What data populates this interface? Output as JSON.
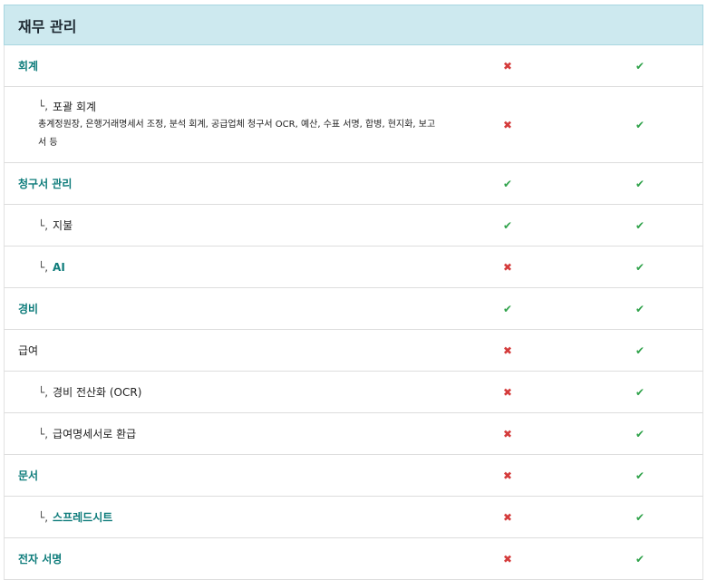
{
  "section": {
    "title": "재무 관리"
  },
  "icons": {
    "check": "✔",
    "cross": "✖",
    "arrow": "└,"
  },
  "colors": {
    "header_bg": "#cde9ef",
    "link": "#0e7c7b",
    "check": "#2fa24a",
    "cross": "#d43a3a"
  },
  "rows": [
    {
      "label": "회계",
      "style": "link",
      "indent": false,
      "col1": "no",
      "col2": "yes"
    },
    {
      "label": "포괄 회계",
      "style": "plain",
      "indent": true,
      "description": "총계정원장, 은행거래명세서 조정, 분석 회계, 공급업체 청구서 OCR, 예산, 수표 서명, 합병, 현지화, 보고서 등",
      "col1": "no",
      "col2": "yes"
    },
    {
      "label": "청구서 관리",
      "style": "link",
      "indent": false,
      "col1": "yes",
      "col2": "yes"
    },
    {
      "label": "지불",
      "style": "plain",
      "indent": true,
      "col1": "yes",
      "col2": "yes"
    },
    {
      "label": "AI",
      "style": "link",
      "indent": true,
      "col1": "no",
      "col2": "yes"
    },
    {
      "label": "경비",
      "style": "link",
      "indent": false,
      "col1": "yes",
      "col2": "yes"
    },
    {
      "label": "급여",
      "style": "plain",
      "indent": false,
      "col1": "no",
      "col2": "yes"
    },
    {
      "label": "경비 전산화 (OCR)",
      "style": "plain",
      "indent": true,
      "col1": "no",
      "col2": "yes"
    },
    {
      "label": "급여명세서로 환급",
      "style": "plain",
      "indent": true,
      "col1": "no",
      "col2": "yes"
    },
    {
      "label": "문서",
      "style": "link",
      "indent": false,
      "col1": "no",
      "col2": "yes"
    },
    {
      "label": "스프레드시트",
      "style": "link",
      "indent": true,
      "col1": "no",
      "col2": "yes"
    },
    {
      "label": "전자 서명",
      "style": "link",
      "indent": false,
      "col1": "no",
      "col2": "yes"
    }
  ]
}
